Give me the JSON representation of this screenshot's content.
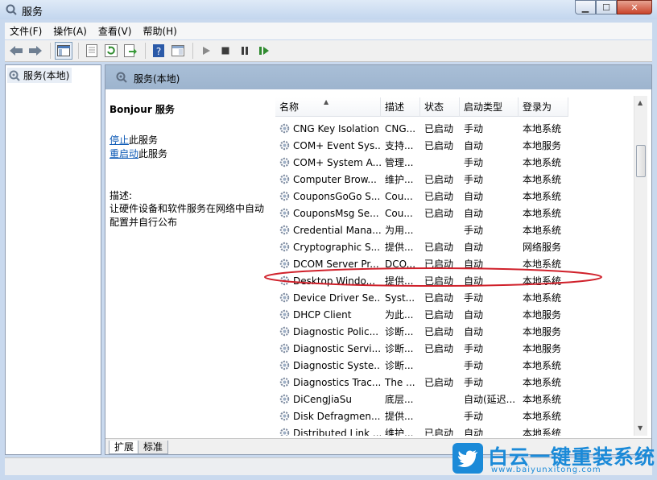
{
  "window": {
    "title": "服务",
    "buttons": {
      "minimize": "▁",
      "maximize": "☐",
      "close": "✕"
    }
  },
  "menu": [
    "文件(F)",
    "操作(A)",
    "查看(V)",
    "帮助(H)"
  ],
  "toolbar": [
    "back-icon",
    "forward-icon",
    "console-tree-icon",
    "properties-icon",
    "refresh-icon",
    "export-icon",
    "help-icon",
    "view-icon",
    "start-icon",
    "stop-icon",
    "pause-icon",
    "resume-icon"
  ],
  "tree": {
    "root": "服务(本地)"
  },
  "pane": {
    "header": "服务(本地)"
  },
  "detail": {
    "service_name": "Bonjour 服务",
    "stop_link": "停止",
    "stop_suffix": "此服务",
    "restart_link": "重启动",
    "restart_suffix": "此服务",
    "desc_label": "描述:",
    "desc_line1": "让硬件设备和软件服务在网络中自动",
    "desc_line2": "配置并自行公布"
  },
  "columns": [
    "名称",
    "描述",
    "状态",
    "启动类型",
    "登录为"
  ],
  "rows": [
    [
      "CNG Key Isolation",
      "CNG...",
      "已启动",
      "手动",
      "本地系统"
    ],
    [
      "COM+ Event Sys...",
      "支持...",
      "已启动",
      "自动",
      "本地服务"
    ],
    [
      "COM+ System A...",
      "管理...",
      "",
      "手动",
      "本地系统"
    ],
    [
      "Computer Brow...",
      "维护...",
      "已启动",
      "手动",
      "本地系统"
    ],
    [
      "CouponsGoGo S...",
      "Cou...",
      "已启动",
      "自动",
      "本地系统"
    ],
    [
      "CouponsMsg Se...",
      "Cou...",
      "已启动",
      "自动",
      "本地系统"
    ],
    [
      "Credential Mana...",
      "为用...",
      "",
      "手动",
      "本地系统"
    ],
    [
      "Cryptographic S...",
      "提供...",
      "已启动",
      "自动",
      "网络服务"
    ],
    [
      "DCOM Server Pr...",
      "DCO...",
      "已启动",
      "自动",
      "本地系统"
    ],
    [
      "Desktop Windo...",
      "提供...",
      "已启动",
      "自动",
      "本地系统"
    ],
    [
      "Device Driver Se...",
      "Syst...",
      "已启动",
      "手动",
      "本地系统"
    ],
    [
      "DHCP Client",
      "为此...",
      "已启动",
      "自动",
      "本地服务"
    ],
    [
      "Diagnostic Polic...",
      "诊断...",
      "已启动",
      "自动",
      "本地服务"
    ],
    [
      "Diagnostic Servi...",
      "诊断...",
      "已启动",
      "手动",
      "本地服务"
    ],
    [
      "Diagnostic Syste...",
      "诊断...",
      "",
      "手动",
      "本地系统"
    ],
    [
      "Diagnostics Trac...",
      "The ...",
      "已启动",
      "手动",
      "本地系统"
    ],
    [
      "DiCengJiaSu",
      "底层...",
      "",
      "自动(延迟...",
      "本地系统"
    ],
    [
      "Disk Defragmen...",
      "提供...",
      "",
      "手动",
      "本地系统"
    ],
    [
      "Distributed Link ...",
      "维护...",
      "已启动",
      "自动",
      "本地系统"
    ]
  ],
  "tabs": [
    "扩展",
    "标准"
  ],
  "watermark": {
    "brand": "白云一键重装系统",
    "url": "www.baiyunxitong.com"
  },
  "colors": {
    "accent": "#1b8ad8",
    "highlight": "#d0212b",
    "link": "#0b58b5"
  }
}
